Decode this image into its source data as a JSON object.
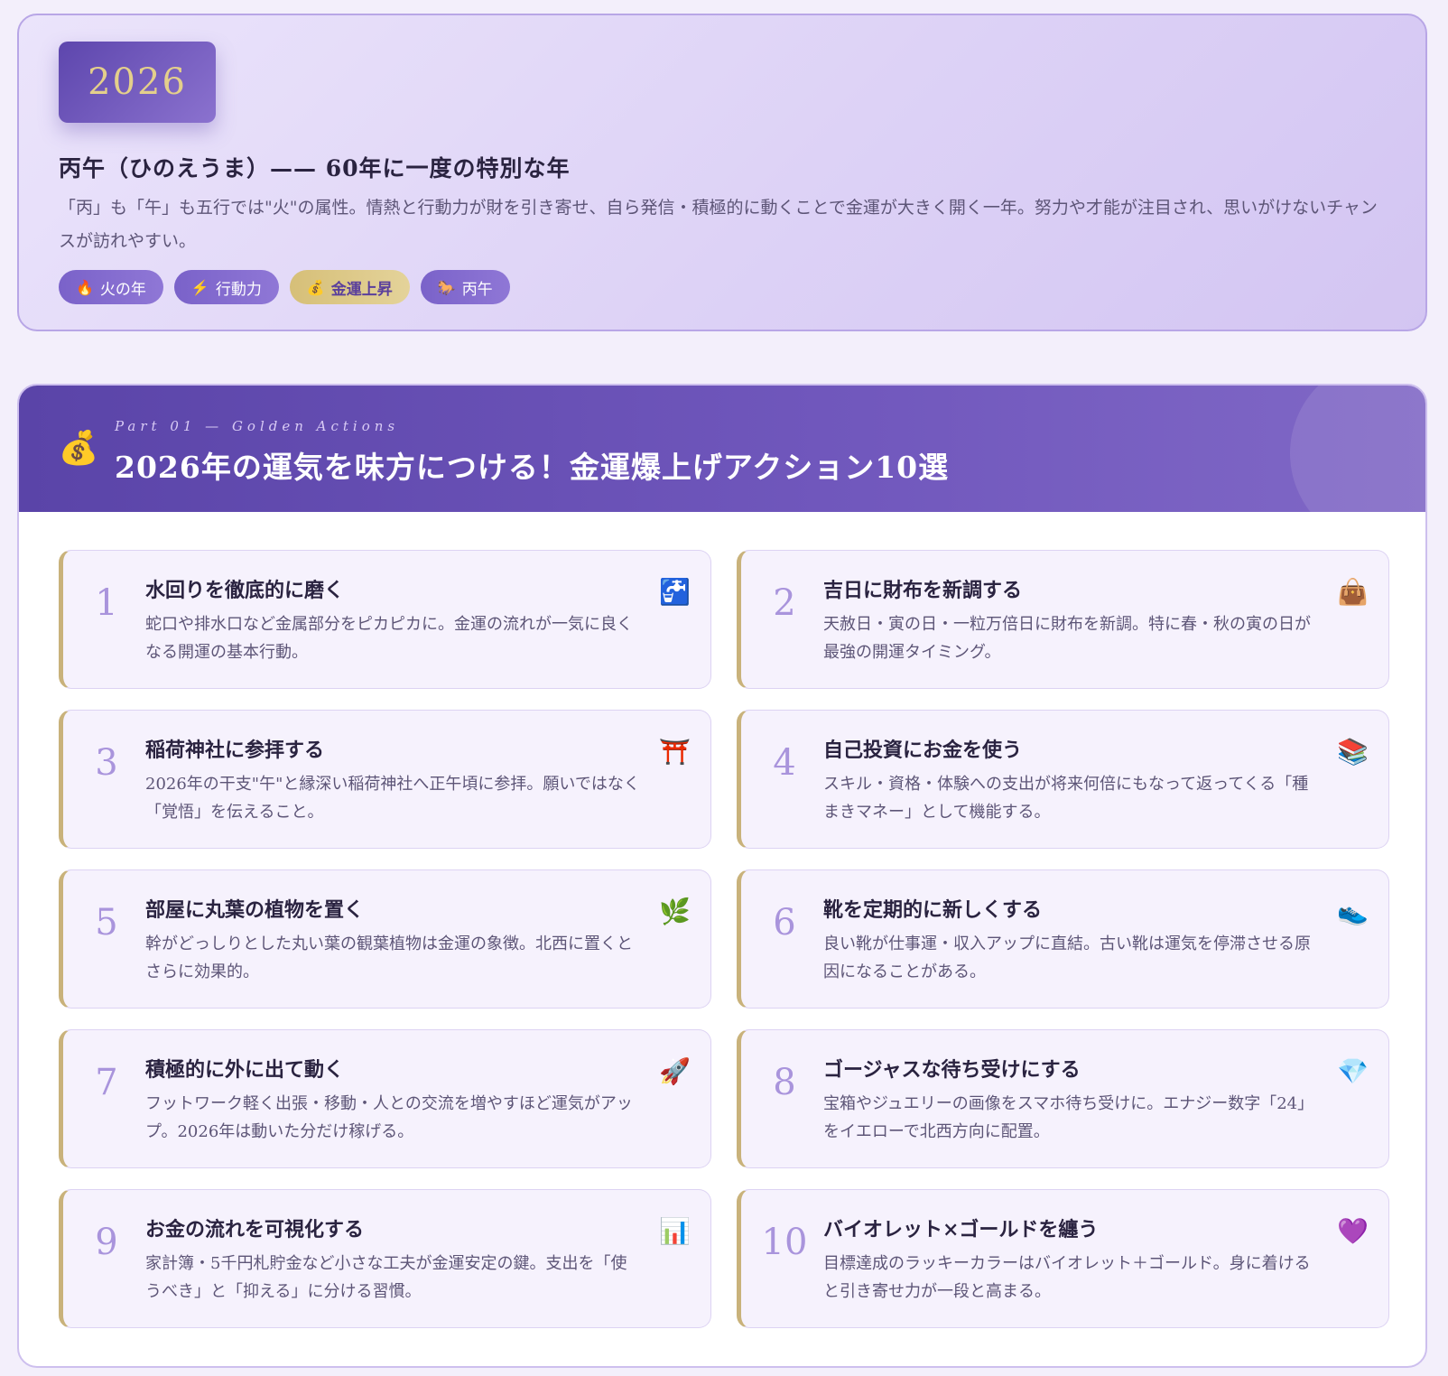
{
  "hero": {
    "year": "2026",
    "title": "丙午（ひのえうま）—— 60年に一度の特別な年",
    "description": "「丙」も「午」も五行では\"火\"の属性。情熱と行動力が財を引き寄せ、自ら発信・積極的に動くことで金運が大きく開く一年。努力や才能が注目され、思いがけないチャンスが訪れやすい。",
    "tags": [
      {
        "icon": "🔥",
        "icon_name": "fire-icon",
        "label": "火の年"
      },
      {
        "icon": "⚡",
        "icon_name": "lightning-icon",
        "label": "行動力"
      },
      {
        "icon": "💰",
        "icon_name": "money-bag-icon",
        "label": "金運上昇"
      },
      {
        "icon": "🐎",
        "icon_name": "horse-icon",
        "label": "丙午"
      }
    ]
  },
  "section": {
    "icon": "💰",
    "kicker": "Part 01 — Golden Actions",
    "title": "2026年の運気を味方につける！金運爆上げアクション10選",
    "items": [
      {
        "num": "1",
        "title": "水回りを徹底的に磨く",
        "desc": "蛇口や排水口など金属部分をピカピカに。金運の流れが一気に良くなる開運の基本行動。",
        "icon": "🚰",
        "icon_name": "faucet-icon"
      },
      {
        "num": "2",
        "title": "吉日に財布を新調する",
        "desc": "天赦日・寅の日・一粒万倍日に財布を新調。特に春・秋の寅の日が最強の開運タイミング。",
        "icon": "👜",
        "icon_name": "handbag-icon"
      },
      {
        "num": "3",
        "title": "稲荷神社に参拝する",
        "desc": "2026年の干支\"午\"と縁深い稲荷神社へ正午頃に参拝。願いではなく「覚悟」を伝えること。",
        "icon": "⛩️",
        "icon_name": "torii-gate-icon"
      },
      {
        "num": "4",
        "title": "自己投資にお金を使う",
        "desc": "スキル・資格・体験への支出が将来何倍にもなって返ってくる「種まきマネー」として機能する。",
        "icon": "📚",
        "icon_name": "books-icon"
      },
      {
        "num": "5",
        "title": "部屋に丸葉の植物を置く",
        "desc": "幹がどっしりとした丸い葉の観葉植物は金運の象徴。北西に置くとさらに効果的。",
        "icon": "🌿",
        "icon_name": "herb-icon"
      },
      {
        "num": "6",
        "title": "靴を定期的に新しくする",
        "desc": "良い靴が仕事運・収入アップに直結。古い靴は運気を停滞させる原因になることがある。",
        "icon": "👟",
        "icon_name": "sneaker-icon"
      },
      {
        "num": "7",
        "title": "積極的に外に出て動く",
        "desc": "フットワーク軽く出張・移動・人との交流を増やすほど運気がアップ。2026年は動いた分だけ稼げる。",
        "icon": "🚀",
        "icon_name": "rocket-icon"
      },
      {
        "num": "8",
        "title": "ゴージャスな待ち受けにする",
        "desc": "宝箱やジュエリーの画像をスマホ待ち受けに。エナジー数字「24」をイエローで北西方向に配置。",
        "icon": "💎",
        "icon_name": "gem-icon"
      },
      {
        "num": "9",
        "title": "お金の流れを可視化する",
        "desc": "家計簿・5千円札貯金など小さな工夫が金運安定の鍵。支出を「使うべき」と「抑える」に分ける習慣。",
        "icon": "📊",
        "icon_name": "bar-chart-icon"
      },
      {
        "num": "10",
        "title": "バイオレット×ゴールドを纏う",
        "desc": "目標達成のラッキーカラーはバイオレット＋ゴールド。身に着けると引き寄せ力が一段と高まる。",
        "icon": "💜",
        "icon_name": "purple-heart-icon"
      }
    ]
  },
  "colors": {
    "primary": "#5a44a8",
    "gold": "#e4cf8b",
    "background": "#f3effb"
  }
}
